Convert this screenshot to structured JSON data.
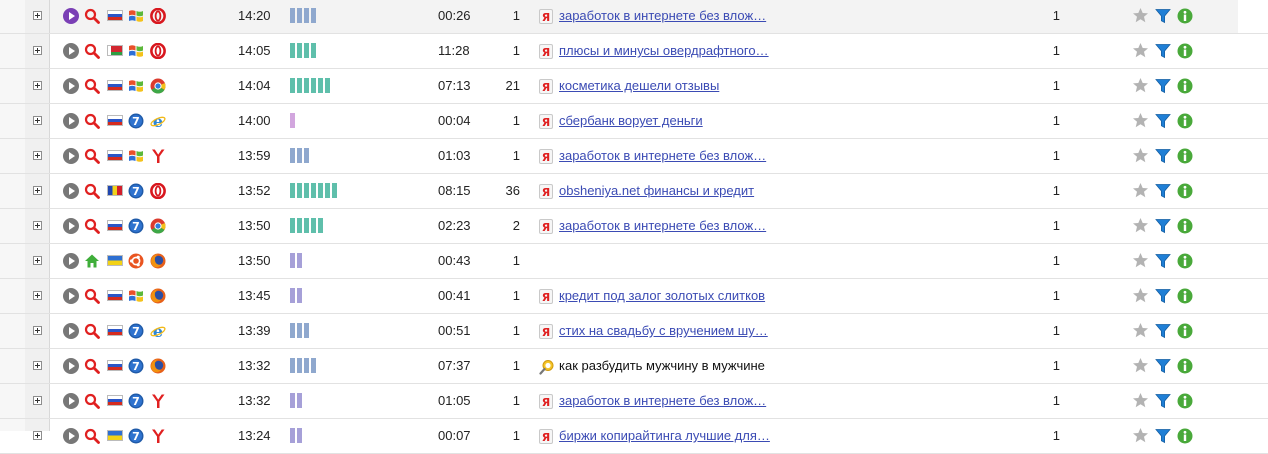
{
  "colors": {
    "bar_teal": "#5fbfab",
    "bar_blue": "#8fa8ce",
    "bar_lilac": "#a6a0d8",
    "bar_pink": "#d2a6de",
    "link": "#3b4bb4",
    "play_active": "#7a3fb5"
  },
  "rows": [
    {
      "time": "14:20",
      "duration": "00:26",
      "pageviews": "1",
      "query": "заработок в интернете без влож…",
      "count": "1",
      "source": "search-icon",
      "flag": "ru",
      "os": "windows-xp-icon",
      "browser": "opera-icon",
      "bars": 4,
      "bar_color": "#8fa8ce",
      "query_icon": "yandex-icon",
      "play_active": true,
      "highlight": true
    },
    {
      "time": "14:05",
      "duration": "11:28",
      "pageviews": "1",
      "query": "плюсы и минусы овердрафтного…",
      "count": "1",
      "source": "search-icon",
      "flag": "by",
      "os": "windows-xp-icon",
      "browser": "opera-icon",
      "bars": 4,
      "bar_color": "#5fbfab",
      "query_icon": "yandex-icon",
      "play_active": false,
      "highlight": false
    },
    {
      "time": "14:04",
      "duration": "07:13",
      "pageviews": "21",
      "query": "косметика дешели отзывы",
      "count": "1",
      "source": "search-icon",
      "flag": "ru",
      "os": "windows-xp-icon",
      "browser": "chrome-icon",
      "bars": 6,
      "bar_color": "#5fbfab",
      "query_icon": "yandex-icon",
      "play_active": false,
      "highlight": false
    },
    {
      "time": "14:00",
      "duration": "00:04",
      "pageviews": "1",
      "query": "сбербанк ворует деньги",
      "count": "1",
      "source": "search-icon",
      "flag": "ru",
      "os": "windows-7-icon",
      "browser": "ie-icon",
      "bars": 1,
      "bar_color": "#d2a6de",
      "query_icon": "yandex-icon",
      "play_active": false,
      "highlight": false
    },
    {
      "time": "13:59",
      "duration": "01:03",
      "pageviews": "1",
      "query": "заработок в интернете без влож…",
      "count": "1",
      "source": "search-icon",
      "flag": "ru",
      "os": "windows-xp-icon",
      "browser": "yandex-browser-icon",
      "bars": 3,
      "bar_color": "#8fa8ce",
      "query_icon": "yandex-icon",
      "play_active": false,
      "highlight": false
    },
    {
      "time": "13:52",
      "duration": "08:15",
      "pageviews": "36",
      "query": "obsheniya.net финансы и кредит",
      "count": "1",
      "source": "search-icon",
      "flag": "md",
      "os": "windows-7-icon",
      "browser": "opera-icon",
      "bars": 7,
      "bar_color": "#5fbfab",
      "query_icon": "yandex-icon",
      "play_active": false,
      "highlight": false
    },
    {
      "time": "13:50",
      "duration": "02:23",
      "pageviews": "2",
      "query": "заработок в интернете без влож…",
      "count": "1",
      "source": "search-icon",
      "flag": "ru",
      "os": "windows-7-icon",
      "browser": "chrome-icon",
      "bars": 5,
      "bar_color": "#5fbfab",
      "query_icon": "yandex-icon",
      "play_active": false,
      "highlight": false
    },
    {
      "time": "13:50",
      "duration": "00:43",
      "pageviews": "1",
      "query": "",
      "count": "1",
      "source": "home-icon",
      "flag": "ua",
      "os": "ubuntu-icon",
      "browser": "firefox-icon",
      "bars": 2,
      "bar_color": "#a6a0d8",
      "query_icon": "",
      "play_active": false,
      "highlight": false
    },
    {
      "time": "13:45",
      "duration": "00:41",
      "pageviews": "1",
      "query": "кредит под залог золотых слитков",
      "count": "1",
      "source": "search-icon",
      "flag": "ru",
      "os": "windows-xp-icon",
      "browser": "firefox-icon",
      "bars": 2,
      "bar_color": "#a6a0d8",
      "query_icon": "yandex-icon",
      "play_active": false,
      "highlight": false
    },
    {
      "time": "13:39",
      "duration": "00:51",
      "pageviews": "1",
      "query": "стих на свадьбу с вручением шу…",
      "count": "1",
      "source": "search-icon",
      "flag": "ru",
      "os": "windows-7-icon",
      "browser": "ie-icon",
      "bars": 3,
      "bar_color": "#8fa8ce",
      "query_icon": "yandex-icon",
      "play_active": false,
      "highlight": false
    },
    {
      "time": "13:32",
      "duration": "07:37",
      "pageviews": "1",
      "query": "как разбудить мужчину в мужчине",
      "count": "1",
      "source": "search-icon",
      "flag": "ru",
      "os": "windows-7-icon",
      "browser": "firefox-icon",
      "bars": 4,
      "bar_color": "#8fa8ce",
      "query_icon": "mail-search-icon",
      "play_active": false,
      "highlight": false
    },
    {
      "time": "13:32",
      "duration": "01:05",
      "pageviews": "1",
      "query": "заработок в интернете без влож…",
      "count": "1",
      "source": "search-icon",
      "flag": "ru",
      "os": "windows-7-icon",
      "browser": "yandex-browser-icon",
      "bars": 2,
      "bar_color": "#a6a0d8",
      "query_icon": "yandex-icon",
      "play_active": false,
      "highlight": false
    },
    {
      "time": "13:24",
      "duration": "00:07",
      "pageviews": "1",
      "query": "биржи копирайтинга лучшие для…",
      "count": "1",
      "source": "search-icon",
      "flag": "ua",
      "os": "windows-7-icon",
      "browser": "yandex-browser-icon",
      "bars": 2,
      "bar_color": "#a6a0d8",
      "query_icon": "yandex-icon",
      "play_active": false,
      "highlight": false
    }
  ]
}
